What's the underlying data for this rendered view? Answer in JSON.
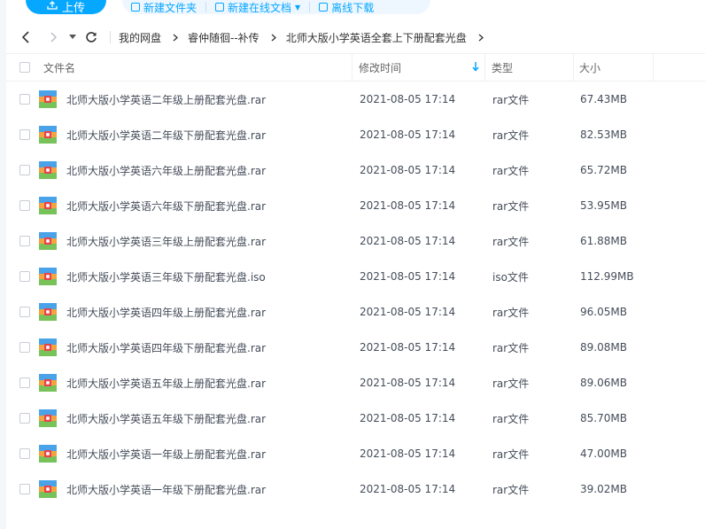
{
  "toolbar": {
    "upload_label": "上传",
    "new_folder_label": "新建文件夹",
    "new_online_doc_label": "新建在线文档",
    "offline_download_label": "离线下载"
  },
  "breadcrumb": {
    "items": [
      "我的网盘",
      "睿仲随徊--补传",
      "北师大版小学英语全套上下册配套光盘"
    ]
  },
  "table": {
    "headers": {
      "name": "文件名",
      "mtime": "修改时间",
      "type": "类型",
      "size": "大小"
    },
    "rows": [
      {
        "name": "北师大版小学英语二年级上册配套光盘.rar",
        "mtime": "2021-08-05 17:14",
        "type": "rar文件",
        "size": "67.43MB"
      },
      {
        "name": "北师大版小学英语二年级下册配套光盘.rar",
        "mtime": "2021-08-05 17:14",
        "type": "rar文件",
        "size": "82.53MB"
      },
      {
        "name": "北师大版小学英语六年级上册配套光盘.rar",
        "mtime": "2021-08-05 17:14",
        "type": "rar文件",
        "size": "65.72MB"
      },
      {
        "name": "北师大版小学英语六年级下册配套光盘.rar",
        "mtime": "2021-08-05 17:14",
        "type": "rar文件",
        "size": "53.95MB"
      },
      {
        "name": "北师大版小学英语三年级上册配套光盘.rar",
        "mtime": "2021-08-05 17:14",
        "type": "rar文件",
        "size": "61.88MB"
      },
      {
        "name": "北师大版小学英语三年级下册配套光盘.iso",
        "mtime": "2021-08-05 17:14",
        "type": "iso文件",
        "size": "112.99MB"
      },
      {
        "name": "北师大版小学英语四年级上册配套光盘.rar",
        "mtime": "2021-08-05 17:14",
        "type": "rar文件",
        "size": "96.05MB"
      },
      {
        "name": "北师大版小学英语四年级下册配套光盘.rar",
        "mtime": "2021-08-05 17:14",
        "type": "rar文件",
        "size": "89.08MB"
      },
      {
        "name": "北师大版小学英语五年级上册配套光盘.rar",
        "mtime": "2021-08-05 17:14",
        "type": "rar文件",
        "size": "89.06MB"
      },
      {
        "name": "北师大版小学英语五年级下册配套光盘.rar",
        "mtime": "2021-08-05 17:14",
        "type": "rar文件",
        "size": "85.70MB"
      },
      {
        "name": "北师大版小学英语一年级上册配套光盘.rar",
        "mtime": "2021-08-05 17:14",
        "type": "rar文件",
        "size": "47.00MB"
      },
      {
        "name": "北师大版小学英语一年级下册配套光盘.rar",
        "mtime": "2021-08-05 17:14",
        "type": "rar文件",
        "size": "39.02MB"
      }
    ]
  },
  "icons": {
    "archive": "archive-file-icon",
    "sort": "sort-arrow-down-icon"
  },
  "colors": {
    "accent": "#06a7ff",
    "toolbar_bg": "#eef6ff",
    "text": "#454d5a"
  }
}
